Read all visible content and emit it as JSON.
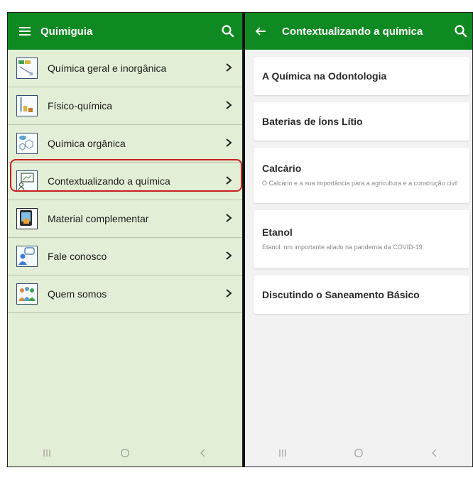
{
  "left": {
    "title": "Quimiguia",
    "items": [
      {
        "label": "Química geral e inorgânica",
        "icon": "flask-icon"
      },
      {
        "label": "Físico-química",
        "icon": "chemistry-lab-icon"
      },
      {
        "label": "Química orgânica",
        "icon": "molecule-icon"
      },
      {
        "label": "Contextualizando a química",
        "icon": "presentation-board-icon"
      },
      {
        "label": "Material complementar",
        "icon": "tablet-book-icon"
      },
      {
        "label": "Fale conosco",
        "icon": "chat-person-icon"
      },
      {
        "label": "Quem somos",
        "icon": "team-icon"
      }
    ],
    "selected_index": 3
  },
  "right": {
    "title": "Contextualizando a química",
    "cards": [
      {
        "title": "A Química na Odontologia",
        "subtitle": ""
      },
      {
        "title": "Baterias de Íons Lítio",
        "subtitle": ""
      },
      {
        "title": "Calcário",
        "subtitle": "O Calcário e a sua importância para a agricultura e a construção civil"
      },
      {
        "title": "Etanol",
        "subtitle": "Etanol: um importante aliado na pandemia da COVID-19"
      },
      {
        "title": "Discutindo o Saneamento Básico",
        "subtitle": ""
      }
    ]
  },
  "colors": {
    "appbar": "#0f8a22",
    "left_background": "#e3eed6",
    "right_background": "#f2f2f2",
    "highlight": "#c8201c"
  }
}
